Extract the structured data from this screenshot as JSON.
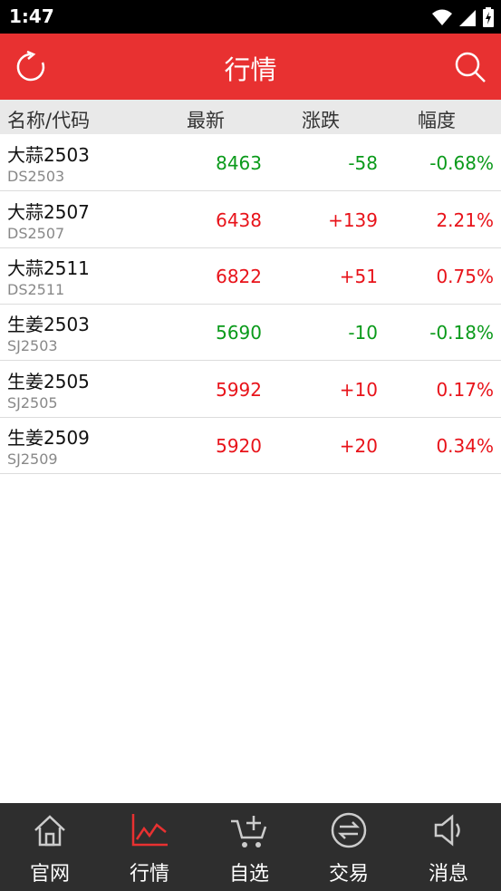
{
  "status_bar": {
    "time": "1:47"
  },
  "header": {
    "title": "行情"
  },
  "columns": {
    "name_code": "名称/代码",
    "latest": "最新",
    "change": "涨跌",
    "range": "幅度"
  },
  "rows": [
    {
      "name": "大蒜2503",
      "code": "DS2503",
      "latest": "8463",
      "change": "-58",
      "pct": "-0.68%",
      "trend": "down"
    },
    {
      "name": "大蒜2507",
      "code": "DS2507",
      "latest": "6438",
      "change": "+139",
      "pct": "2.21%",
      "trend": "up"
    },
    {
      "name": "大蒜2511",
      "code": "DS2511",
      "latest": "6822",
      "change": "+51",
      "pct": "0.75%",
      "trend": "up"
    },
    {
      "name": "生姜2503",
      "code": "SJ2503",
      "latest": "5690",
      "change": "-10",
      "pct": "-0.18%",
      "trend": "down"
    },
    {
      "name": "生姜2505",
      "code": "SJ2505",
      "latest": "5992",
      "change": "+10",
      "pct": "0.17%",
      "trend": "up"
    },
    {
      "name": "生姜2509",
      "code": "SJ2509",
      "latest": "5920",
      "change": "+20",
      "pct": "0.34%",
      "trend": "up"
    }
  ],
  "tabs": [
    {
      "label": "官网",
      "icon": "home-icon"
    },
    {
      "label": "行情",
      "icon": "chart-icon",
      "active": true
    },
    {
      "label": "自选",
      "icon": "cart-icon"
    },
    {
      "label": "交易",
      "icon": "exchange-icon"
    },
    {
      "label": "消息",
      "icon": "speaker-icon"
    }
  ],
  "colors": {
    "brand_red": "#e83131",
    "up": "#e8131a",
    "down": "#0a9a1a",
    "tabbar": "#2e2e2e"
  }
}
